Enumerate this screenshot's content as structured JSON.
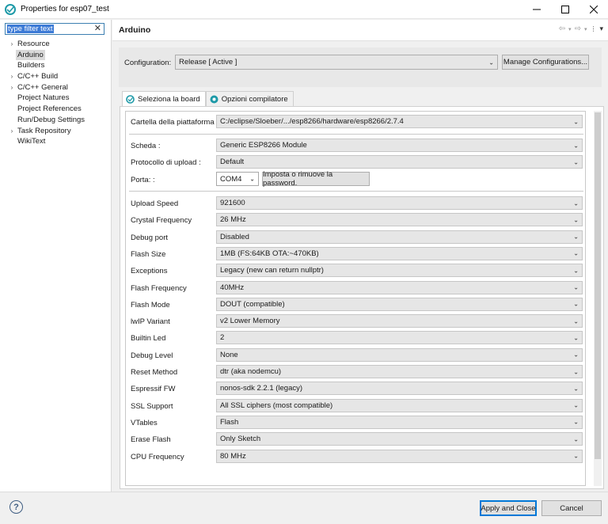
{
  "window": {
    "title": "Properties for esp07_test"
  },
  "sidebar": {
    "filter_value": "type filter text",
    "items": [
      {
        "label": "Resource",
        "expandable": true
      },
      {
        "label": "Arduino",
        "expandable": false,
        "selected": true
      },
      {
        "label": "Builders",
        "expandable": false
      },
      {
        "label": "C/C++ Build",
        "expandable": true
      },
      {
        "label": "C/C++ General",
        "expandable": true
      },
      {
        "label": "Project Natures",
        "expandable": false
      },
      {
        "label": "Project References",
        "expandable": false
      },
      {
        "label": "Run/Debug Settings",
        "expandable": false
      },
      {
        "label": "Task Repository",
        "expandable": true
      },
      {
        "label": "WikiText",
        "expandable": false
      }
    ]
  },
  "page": {
    "title": "Arduino"
  },
  "configuration": {
    "label": "Configuration:",
    "value": "Release  [ Active ]",
    "manage_button": "Manage Configurations..."
  },
  "tabs": [
    {
      "label": "Seleziona la board",
      "active": true
    },
    {
      "label": "Opzioni compilatore",
      "active": false
    }
  ],
  "board": {
    "platform_label": "Cartella della piattaforma :",
    "platform_value": "C:/eclipse/Sloeber/.../esp8266/hardware/esp8266/2.7.4",
    "scheda_label": "Scheda :",
    "scheda_value": "Generic ESP8266 Module",
    "protocol_label": "Protocollo di upload :",
    "protocol_value": "Default",
    "porta_label": "Porta: :",
    "porta_value": "COM4",
    "password_button": "Imposta o rimuove la password.",
    "options": [
      {
        "label": "Upload Speed",
        "value": "921600"
      },
      {
        "label": "Crystal Frequency",
        "value": "26 MHz"
      },
      {
        "label": "Debug port",
        "value": "Disabled"
      },
      {
        "label": "Flash Size",
        "value": "1MB (FS:64KB OTA:~470KB)"
      },
      {
        "label": "Exceptions",
        "value": "Legacy (new can return nullptr)"
      },
      {
        "label": "Flash Frequency",
        "value": "40MHz"
      },
      {
        "label": "Flash Mode",
        "value": "DOUT (compatible)"
      },
      {
        "label": "lwIP Variant",
        "value": "v2 Lower Memory"
      },
      {
        "label": "Builtin Led",
        "value": "2"
      },
      {
        "label": "Debug Level",
        "value": "None"
      },
      {
        "label": "Reset Method",
        "value": "dtr (aka nodemcu)"
      },
      {
        "label": "Espressif FW",
        "value": "nonos-sdk 2.2.1 (legacy)"
      },
      {
        "label": "SSL Support",
        "value": "All SSL ciphers (most compatible)"
      },
      {
        "label": "VTables",
        "value": "Flash"
      },
      {
        "label": "Erase Flash",
        "value": "Only Sketch"
      },
      {
        "label": "CPU Frequency",
        "value": "80 MHz"
      }
    ]
  },
  "footer": {
    "help_glyph": "?",
    "apply_close": "Apply and Close",
    "cancel": "Cancel"
  },
  "colors": {
    "accent": "#0078d7",
    "selection": "#3d7bd6"
  }
}
